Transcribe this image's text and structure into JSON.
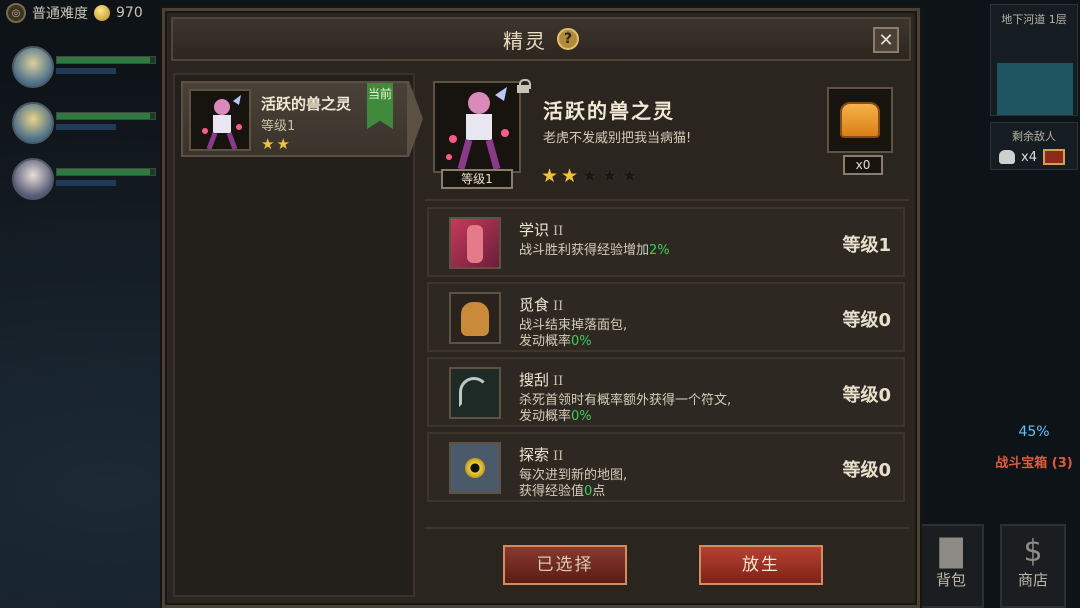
{
  "topbar": {
    "difficulty": "普通难度",
    "coins": "970"
  },
  "side": {
    "floor": "地下河道 1层",
    "remaining_enemies_label": "剩余敌人",
    "remaining_enemies_count": "x4",
    "battle_chest_pct": "45%",
    "battle_chest_label": "战斗宝箱 (3)",
    "bag_label": "背包",
    "shop_label": "商店"
  },
  "panel": {
    "title": "精灵",
    "help": "?",
    "close": "✕"
  },
  "list": {
    "items": [
      {
        "name": "活跃的兽之灵",
        "level": "等级1",
        "stars": "★★",
        "tag": "当前"
      }
    ]
  },
  "detail": {
    "name": "活跃的兽之灵",
    "desc": "老虎不发威别把我当病猫!",
    "level_tag": "等级1",
    "stars_on": "★★",
    "stars_off": "★★★",
    "bread_count": "x0"
  },
  "skills": [
    {
      "name": "学识",
      "rank": "II",
      "desc1": "战斗胜利获得经验增加",
      "value": "2%",
      "desc2": "",
      "suffix": "",
      "level": "等级1"
    },
    {
      "name": "觅食",
      "rank": "II",
      "desc1": "战斗结束掉落面包,",
      "desc2": "发动概率",
      "value": "0%",
      "suffix": "",
      "level": "等级0"
    },
    {
      "name": "搜刮",
      "rank": "II",
      "desc1": "杀死首领时有概率额外获得一个符文,",
      "desc2": "发动概率",
      "value": "0%",
      "suffix": "",
      "level": "等级0"
    },
    {
      "name": "探索",
      "rank": "II",
      "desc1": "每次进到新的地图,",
      "desc2": "获得经验值",
      "value": "0",
      "suffix": "点",
      "level": "等级0"
    }
  ],
  "buttons": {
    "selected": "已选择",
    "release": "放生"
  },
  "heroes": [
    {
      "hp_pct": 0.95
    },
    {
      "hp_pct": 0.95
    },
    {
      "hp_pct": 0.95
    }
  ],
  "colors": {
    "accent_green": "#3fce52",
    "button_red": "#b84030",
    "star_gold": "#f0c23a"
  }
}
